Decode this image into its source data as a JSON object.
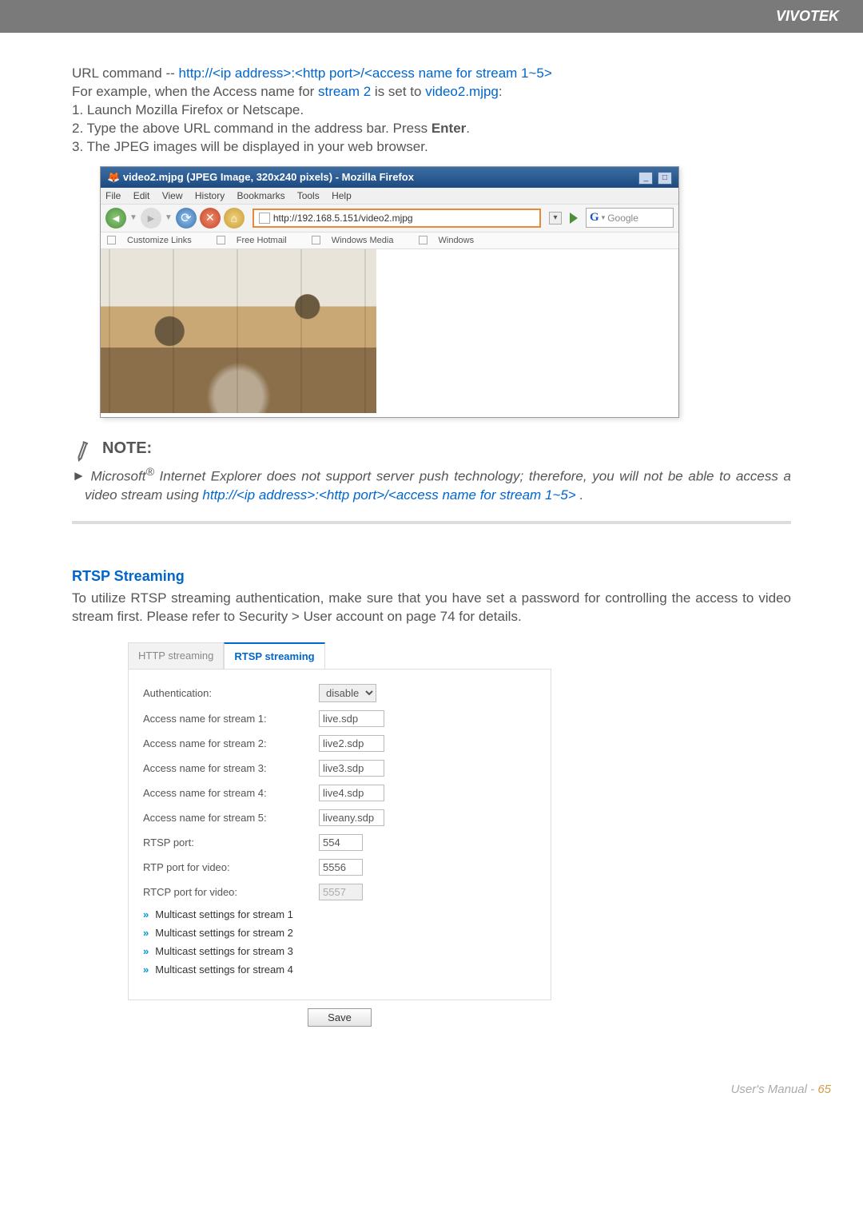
{
  "header": {
    "brand": "VIVOTEK"
  },
  "intro": {
    "url_command_prefix": "URL command -- ",
    "url_command": "http://<ip address>:<http port>/<access name for stream 1~5>",
    "example_prefix": "For example, when the Access name for ",
    "stream_text": "stream 2",
    "example_mid": " is set to ",
    "mjpg_text": "video2.mjpg",
    "example_suffix": ":",
    "step1": "1. Launch Mozilla Firefox or Netscape.",
    "step2_a": "2. Type the above URL command in the address bar. Press ",
    "step2_b": "Enter",
    "step2_c": ".",
    "step3": "3. The JPEG images will be displayed in your web browser."
  },
  "browser": {
    "title": "video2.mjpg (JPEG Image, 320x240 pixels) - Mozilla Firefox",
    "menu": [
      "File",
      "Edit",
      "View",
      "History",
      "Bookmarks",
      "Tools",
      "Help"
    ],
    "address": "http://192.168.5.151/video2.mjpg",
    "search_placeholder": "Google",
    "bookmarks": [
      "Customize Links",
      "Free Hotmail",
      "Windows Media",
      "Windows"
    ]
  },
  "note": {
    "title": "NOTE:",
    "line1a": "Microsoft",
    "line1b": " Internet Explorer does not support server push technology; therefore, you will not be able to access a video stream using ",
    "urlpart": "http://<ip address>:<http port>/<access name for stream 1~5>",
    "line1c": " ."
  },
  "rtsp": {
    "title": "RTSP Streaming",
    "text": "To utilize RTSP streaming authentication, make sure that you have set a password for controlling the access to video stream first. Please refer to Security > User account on page 74 for details."
  },
  "tabs": {
    "http": "HTTP streaming",
    "rtsp": "RTSP streaming"
  },
  "form": {
    "auth_label": "Authentication:",
    "auth_value": "disable",
    "s1_label": "Access name for stream 1:",
    "s1_value": "live.sdp",
    "s2_label": "Access name for stream 2:",
    "s2_value": "live2.sdp",
    "s3_label": "Access name for stream 3:",
    "s3_value": "live3.sdp",
    "s4_label": "Access name for stream 4:",
    "s4_value": "live4.sdp",
    "s5_label": "Access name for stream 5:",
    "s5_value": "liveany.sdp",
    "rtsp_port_label": "RTSP port:",
    "rtsp_port_value": "554",
    "rtp_port_label": "RTP port for video:",
    "rtp_port_value": "5556",
    "rtcp_port_label": "RTCP port for video:",
    "rtcp_port_value": "5557",
    "mc1": "Multicast settings for stream 1",
    "mc2": "Multicast settings for stream 2",
    "mc3": "Multicast settings for stream 3",
    "mc4": "Multicast settings for stream 4",
    "save": "Save"
  },
  "footer": {
    "label": "User's Manual - ",
    "page": "65"
  }
}
